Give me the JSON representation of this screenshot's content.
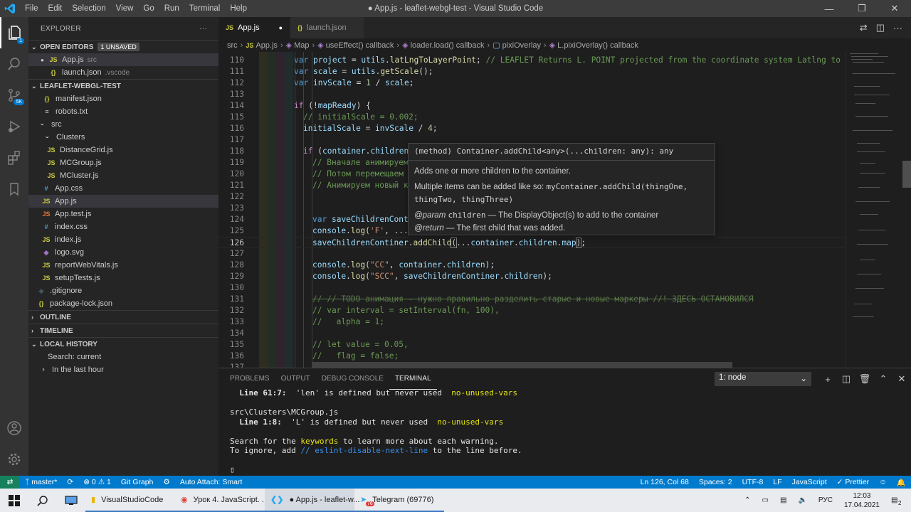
{
  "titlebar": {
    "menu": [
      "File",
      "Edit",
      "Selection",
      "View",
      "Go",
      "Run",
      "Terminal",
      "Help"
    ],
    "title": "● App.js - leaflet-webgl-test - Visual Studio Code"
  },
  "activity": {
    "scm_badge": "5K"
  },
  "sidebar": {
    "header": "EXPLORER",
    "open_editors_title": "OPEN EDITORS",
    "unsaved_badge": "1 UNSAVED",
    "open_editors": [
      {
        "icon": "JS",
        "name": "App.js",
        "dir": "src"
      },
      {
        "icon": "{}",
        "name": "launch.json",
        "dir": ".vscode"
      }
    ],
    "project_title": "LEAFLET-WEBGL-TEST",
    "files": [
      {
        "icon": "{}",
        "name": "manifest.json"
      },
      {
        "icon": "≡",
        "name": "robots.txt"
      },
      {
        "icon": "›",
        "name": "src"
      },
      {
        "icon": "›",
        "name": "Clusters"
      },
      {
        "icon": "JS",
        "name": "DistanceGrid.js"
      },
      {
        "icon": "JS",
        "name": "MCGroup.js"
      },
      {
        "icon": "JS",
        "name": "MCluster.js"
      },
      {
        "icon": "#",
        "name": "App.css"
      },
      {
        "icon": "JS",
        "name": "App.js"
      },
      {
        "icon": "JS",
        "name": "App.test.js"
      },
      {
        "icon": "#",
        "name": "index.css"
      },
      {
        "icon": "JS",
        "name": "index.js"
      },
      {
        "icon": "◆",
        "name": "logo.svg"
      },
      {
        "icon": "JS",
        "name": "reportWebVitals.js"
      },
      {
        "icon": "JS",
        "name": "setupTests.js"
      },
      {
        "icon": "◆",
        "name": ".gitignore"
      },
      {
        "icon": "{}",
        "name": "package-lock.json"
      }
    ],
    "outline_title": "OUTLINE",
    "timeline_title": "TIMELINE",
    "local_history_title": "LOCAL HISTORY",
    "history_items": [
      "Search: current",
      "In the last hour"
    ]
  },
  "tabs": [
    {
      "icon": "JS",
      "label": "App.js",
      "dirty": "●"
    },
    {
      "icon": "{}",
      "label": "launch.json"
    }
  ],
  "breadcrumbs": [
    "src",
    "App.js",
    "Map",
    "useEffect() callback",
    "loader.load() callback",
    "pixiOverlay",
    "L.pixiOverlay() callback"
  ],
  "editor": {
    "line_numbers": [
      "110",
      "111",
      "112",
      "113",
      "114",
      "115",
      "116",
      "117",
      "118",
      "119",
      "120",
      "121",
      "122",
      "123",
      "124",
      "125",
      "126",
      "127",
      "128",
      "129",
      "130",
      "131",
      "132",
      "133",
      "134",
      "135",
      "136",
      "137"
    ],
    "current_line": "126"
  },
  "hover": {
    "signature": "(method) Container.addChild<any>(...children: any): any",
    "description": "Adds one or more children to the container.",
    "multi_text": "Multiple items can be added like so:",
    "multi_code_1": "myContainer.addChild(thingOne,",
    "multi_code_2": "thingTwo, thingThree)",
    "param_tag": "@param",
    "param_name": "children",
    "param_desc": "— The DisplayObject(s) to add to the container",
    "return_tag": "@return",
    "return_desc": "— The first child that was added."
  },
  "panel": {
    "tabs": [
      "PROBLEMS",
      "OUTPUT",
      "DEBUG CONSOLE",
      "TERMINAL"
    ],
    "terminal_select": "1: node",
    "lines": {
      "l1_loc": "Line 61:7:",
      "l1_msg": "'len' is defined but never used",
      "l1_rule": "no-unused-vars",
      "l2": "src\\Clusters\\MCGroup.js",
      "l3_loc": "Line 1:8:",
      "l3_msg": "'L' is defined but never used",
      "l3_rule": "no-unused-vars",
      "l4_a": "Search for the ",
      "l4_kw": "keywords",
      "l4_b": " to learn more about each warning.",
      "l5_a": "To ignore, add ",
      "l5_kw": "// eslint-disable-next-line",
      "l5_b": " to the line before.",
      "cursor": "▯"
    }
  },
  "status": {
    "branch": "master*",
    "errors": "⊗ 0",
    "warnings": "⚠ 1",
    "git_graph": "Git Graph",
    "auto_attach": "Auto Attach: Smart",
    "position": "Ln 126, Col 68",
    "spaces": "Spaces: 2",
    "encoding": "UTF-8",
    "eol": "LF",
    "language": "JavaScript",
    "prettier": "✓ Prettier"
  },
  "taskbar": {
    "apps": [
      "VisualStudioCode",
      "Урок 4. JavaScript. ...",
      "● App.js - leaflet-w...",
      "Telegram (69776)"
    ],
    "telegram_badge": "76",
    "lang": "РУС",
    "time": "12:03",
    "date": "17.04.2021",
    "notif": "2"
  }
}
